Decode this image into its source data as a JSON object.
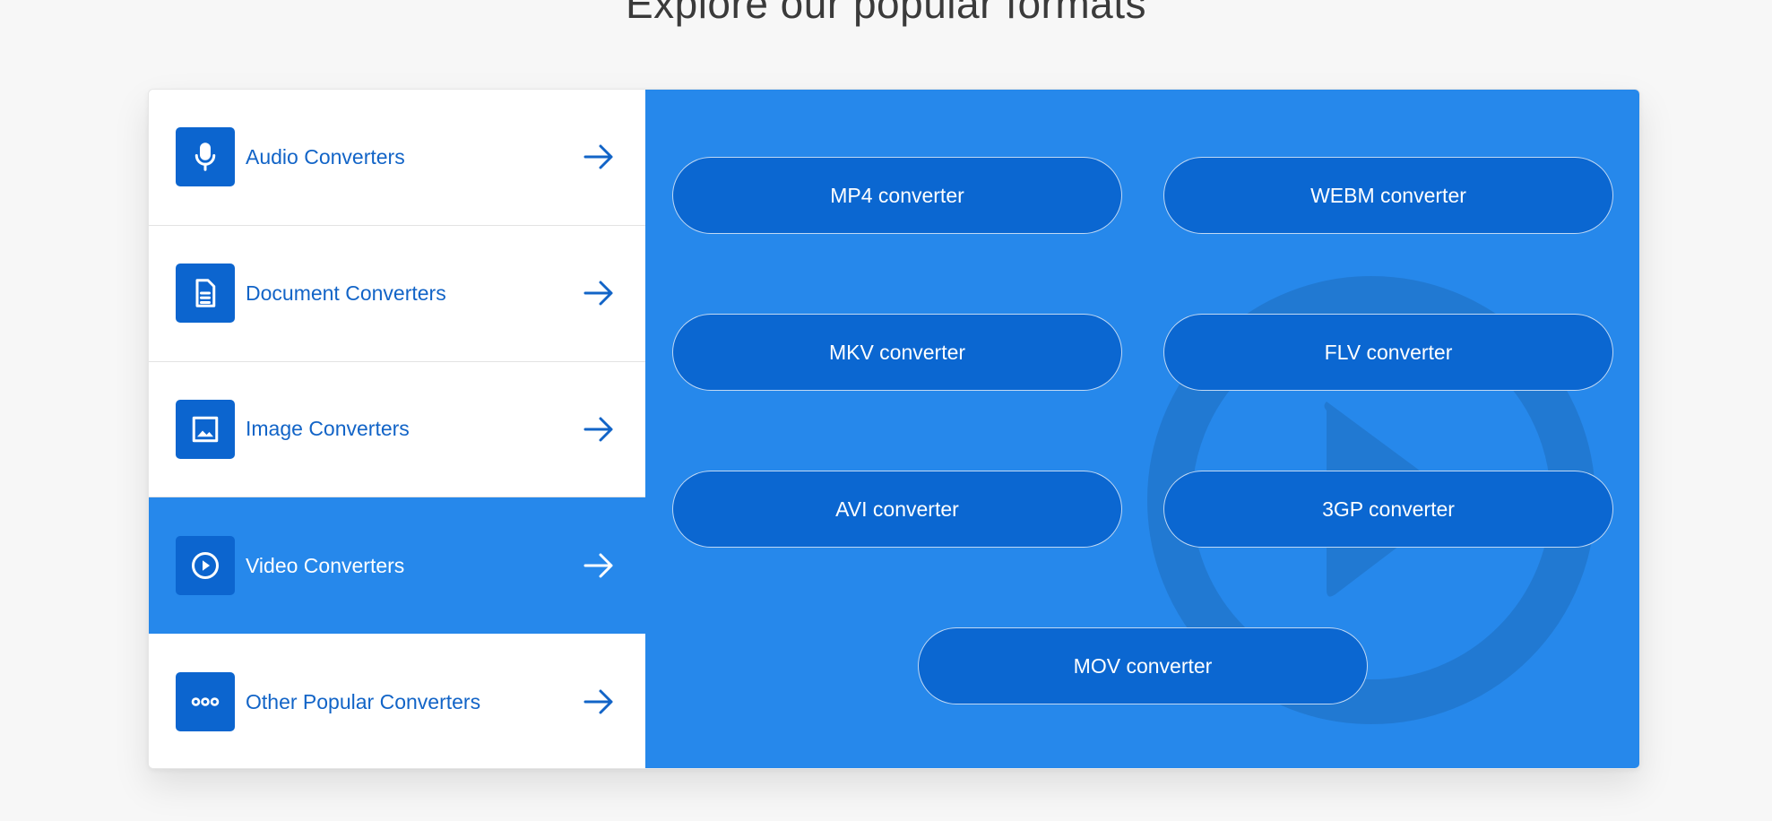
{
  "section": {
    "title": "Explore our popular formats"
  },
  "categories": [
    {
      "label": "Audio Converters",
      "icon": "microphone-icon"
    },
    {
      "label": "Document Converters",
      "icon": "document-icon"
    },
    {
      "label": "Image Converters",
      "icon": "image-icon"
    },
    {
      "label": "Video Converters",
      "icon": "play-circle-icon",
      "active": true
    },
    {
      "label": "Other Popular Converters",
      "icon": "more-dots-icon"
    }
  ],
  "converters": [
    {
      "label": "MP4 converter"
    },
    {
      "label": "WEBM converter"
    },
    {
      "label": "MKV converter"
    },
    {
      "label": "FLV converter"
    },
    {
      "label": "AVI converter"
    },
    {
      "label": "3GP converter"
    },
    {
      "label": "MOV converter"
    }
  ],
  "colors": {
    "accent": "#2688eb",
    "icon_bg": "#0c65cf",
    "button_bg": "#0b67d1",
    "link_text": "#1264c7"
  }
}
